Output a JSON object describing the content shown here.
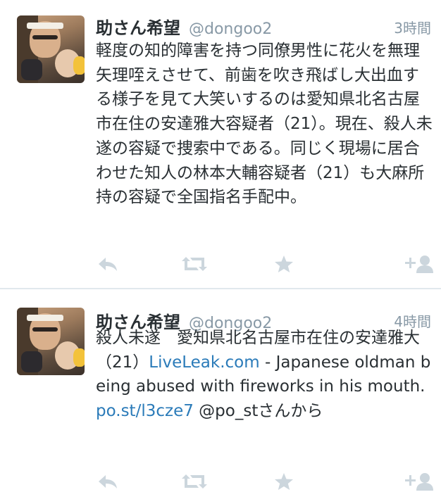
{
  "tweets": [
    {
      "author_name": "助さん希望",
      "handle": "@dongoo2",
      "time": "3時間",
      "text": "軽度の知的障害を持つ同僚男性に花火を無理矢理咥えさせて、前歯を吹き飛ばし大出血する様子を見て大笑いするのは愛知県北名古屋市在住の安達雅大容疑者（21）。現在、殺人未遂の容疑で捜索中である。同じく現場に居合わせた知人の林本大輔容疑者（21）も大麻所持の容疑で全国指名手配中。"
    },
    {
      "author_name": "助さん希望",
      "handle": "@dongoo2",
      "time": "4時間",
      "text_part1": "殺人未遂　愛知県北名古屋市在住の安達雅大（21）",
      "link1": "LiveLeak.com",
      "text_part2": " - Japanese oldman being abused with fireworks in his mouth. ",
      "link2": "po.st/l3cze7",
      "text_part3": " @po_stさんから"
    }
  ],
  "icons": {
    "reply": "reply-icon",
    "retweet": "retweet-icon",
    "favorite": "star-icon",
    "follow": "follow-icon"
  },
  "colors": {
    "icon_gray": "#ccd6dd",
    "link_blue": "#2b7bb9",
    "meta_gray": "#8899a6"
  }
}
